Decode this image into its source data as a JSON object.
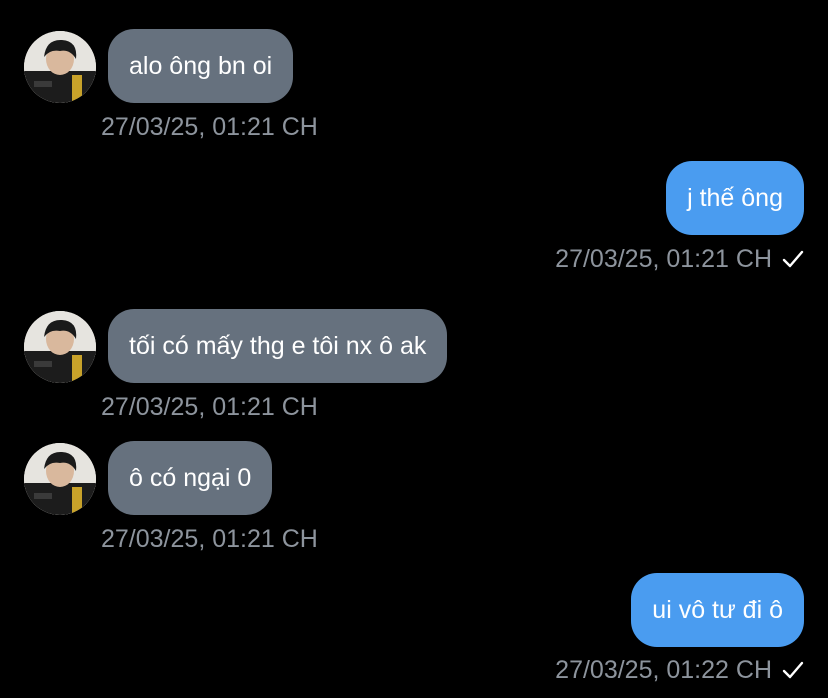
{
  "messages": [
    {
      "direction": "in",
      "text": "alo ông bn oi",
      "time": "27/03/25, 01:21 CH"
    },
    {
      "direction": "out",
      "text": "j thế ông",
      "time": "27/03/25, 01:21 CH",
      "status_icon": "check-icon"
    },
    {
      "direction": "in",
      "text": "tối có mấy thg e tôi nx ô ak",
      "time": "27/03/25, 01:21 CH"
    },
    {
      "direction": "in",
      "text": "ô có ngại 0",
      "time": "27/03/25, 01:21 CH"
    },
    {
      "direction": "out",
      "text": "ui vô tư đi ô",
      "time": "27/03/25, 01:22 CH",
      "status_icon": "check-icon"
    }
  ],
  "colors": {
    "background": "#000000",
    "incoming_bubble": "#66717e",
    "outgoing_bubble": "#4a9cf0",
    "timestamp": "#8d949d"
  }
}
